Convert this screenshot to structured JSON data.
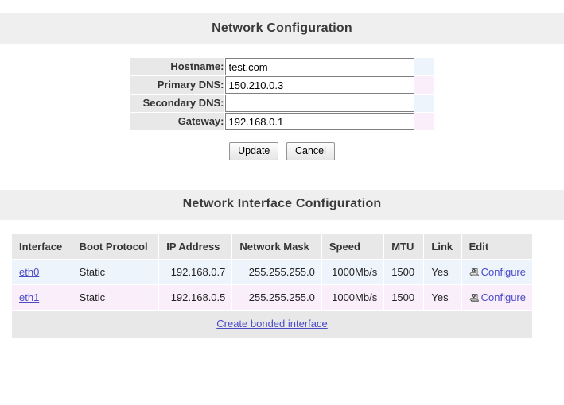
{
  "sections": {
    "network_config_title": "Network Configuration",
    "network_interface_title": "Network Interface Configuration"
  },
  "form": {
    "fields": [
      {
        "label": "Hostname:",
        "value": "test.com",
        "placeholder": ""
      },
      {
        "label": "Primary DNS:",
        "value": "150.210.0.3",
        "placeholder": ""
      },
      {
        "label": "Secondary DNS:",
        "value": "",
        "placeholder": ""
      },
      {
        "label": "Gateway:",
        "value": "192.168.0.1",
        "placeholder": ""
      }
    ],
    "buttons": {
      "update": "Update",
      "cancel": "Cancel"
    }
  },
  "interfaces_table": {
    "columns": [
      "Interface",
      "Boot Protocol",
      "IP Address",
      "Network Mask",
      "Speed",
      "MTU",
      "Link",
      "Edit"
    ],
    "rows": [
      {
        "interface": "eth0",
        "boot_protocol": "Static",
        "ip_address": "192.168.0.7",
        "network_mask": "255.255.255.0",
        "speed": "1000Mb/s",
        "mtu": "1500",
        "link": "Yes",
        "edit_label": "Configure",
        "edit_icon": "configure-scroll-icon"
      },
      {
        "interface": "eth1",
        "boot_protocol": "Static",
        "ip_address": "192.168.0.5",
        "network_mask": "255.255.255.0",
        "speed": "1000Mb/s",
        "mtu": "1500",
        "link": "Yes",
        "edit_label": "Configure",
        "edit_icon": "configure-scroll-icon"
      }
    ],
    "footer_link": "Create bonded interface"
  },
  "colors": {
    "bar_background": "#efefef",
    "label_background": "#e8e8e8",
    "row_blue": "#edf4fb",
    "row_pink": "#f9eefa",
    "link": "#4b4bc8",
    "heading_text": "#3a3a3a"
  }
}
